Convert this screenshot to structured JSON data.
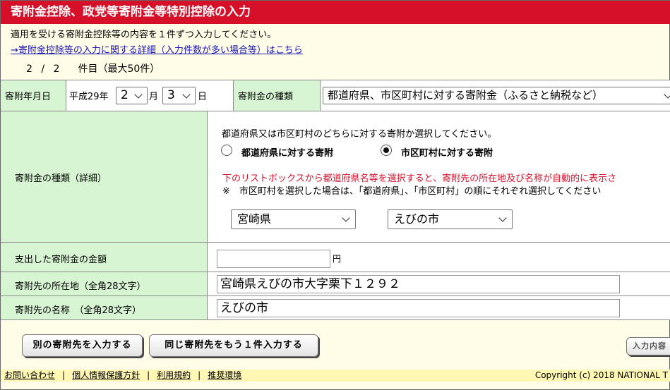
{
  "title": "寄附金控除、政党等寄附金等特別控除の入力",
  "intro": "適用を受ける寄附金控除等の内容を１件ずつ入力してください。",
  "detail_link": "→寄附金控除等の入力に関する詳細（入力件数が多い場合等）はこちら",
  "counter": {
    "current": "2",
    "sep": "/",
    "total": "2",
    "suffix": "件目（最大50件）"
  },
  "date_row": {
    "label": "寄附年月日",
    "era": "平成29年",
    "month_value": "2",
    "month_unit": "月",
    "day_value": "3",
    "day_unit": "日"
  },
  "type_row": {
    "label": "寄附金の種類",
    "selected": "都道府県、市区町村に対する寄附金（ふるさと納税など）"
  },
  "detail_row": {
    "label": "寄附金の種類（詳細）",
    "prompt": "都道府県又は市区町村のどちらに対する寄附か選択してください。",
    "radio_pref": "都道府県に対する寄附",
    "radio_city": "市区町村に対する寄附",
    "selected_radio": "city",
    "note_red": "下のリストボックスから都道府県名等を選択すると、寄附先の所在地及び名称が自動的に表示さ",
    "note": "※　市区町村を選択した場合は、「都道府県」、「市区町村」の順にそれぞれ選択してください",
    "prefecture": "宮崎県",
    "city": "えびの市"
  },
  "amount_row": {
    "label": "支出した寄附金の金額",
    "value": "",
    "unit": "円"
  },
  "address_row": {
    "label": "寄附先の所在地（全角28文字）",
    "value": "宮崎県えびの市大字栗下１２９２"
  },
  "name_row": {
    "label": "寄附先の名称　（全角28文字）",
    "value": "えびの市"
  },
  "buttons": {
    "other": "別の寄附先を入力する",
    "same": "同じ寄附先をもう１件入力する",
    "done": "入力内容"
  },
  "footer": {
    "contact": "お問い合わせ",
    "privacy": "個人情報保護方針",
    "terms": "利用規約",
    "env": "推奨環境",
    "copyright": "Copyright (c) 2018 NATIONAL T"
  },
  "colors": {
    "title_bg": "#d7102a",
    "label_bg": "#d8f5d3",
    "page_bg": "#fffce8",
    "link": "#1a16b3",
    "note_red": "#d7102a"
  }
}
